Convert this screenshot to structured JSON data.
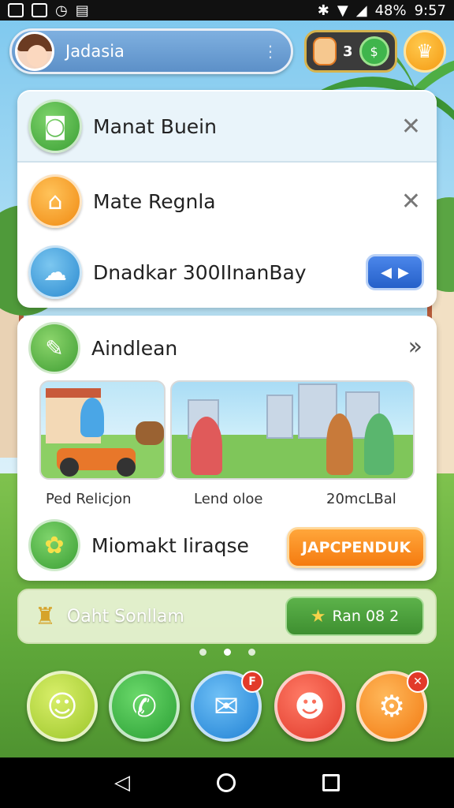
{
  "status_bar": {
    "battery": "48%",
    "time": "9:57"
  },
  "top_bar": {
    "username": "Jadasia",
    "coin_count": "3",
    "coin_badge": "3"
  },
  "notifications": [
    {
      "label": "Manat Buein",
      "icon": "camera-icon",
      "action": "close"
    },
    {
      "label": "Mate Regnla",
      "icon": "home-icon",
      "action": "close"
    },
    {
      "label": "Dnadkar 300IInanBay",
      "icon": "cloud-icon",
      "action": "toggle"
    }
  ],
  "activity": {
    "title": "Aindlean",
    "captions": [
      "Ped Relicjon",
      "Lend oloe",
      "20mcLBal"
    ],
    "footer_label": "Miomakt Iiraqse",
    "footer_button": "JAPCPENDUK"
  },
  "banner": {
    "text": "Oaht Sonllam",
    "button_label": "Ran 08 2"
  },
  "page_indicator": {
    "count": 3,
    "active": 1
  },
  "dock": [
    {
      "name": "ghost-app",
      "icon": "ghost-icon",
      "badge": ""
    },
    {
      "name": "phone-app",
      "icon": "phone-icon",
      "badge": ""
    },
    {
      "name": "messages-app",
      "icon": "chat-bubble-icon",
      "badge": "F"
    },
    {
      "name": "chat-app",
      "icon": "speech-icon",
      "badge": ""
    },
    {
      "name": "settings-app",
      "icon": "gear-icon",
      "badge": "✕"
    }
  ],
  "colors": {
    "accent_blue": "#2560c9",
    "accent_orange": "#f57b10",
    "accent_green": "#3e8f30"
  }
}
